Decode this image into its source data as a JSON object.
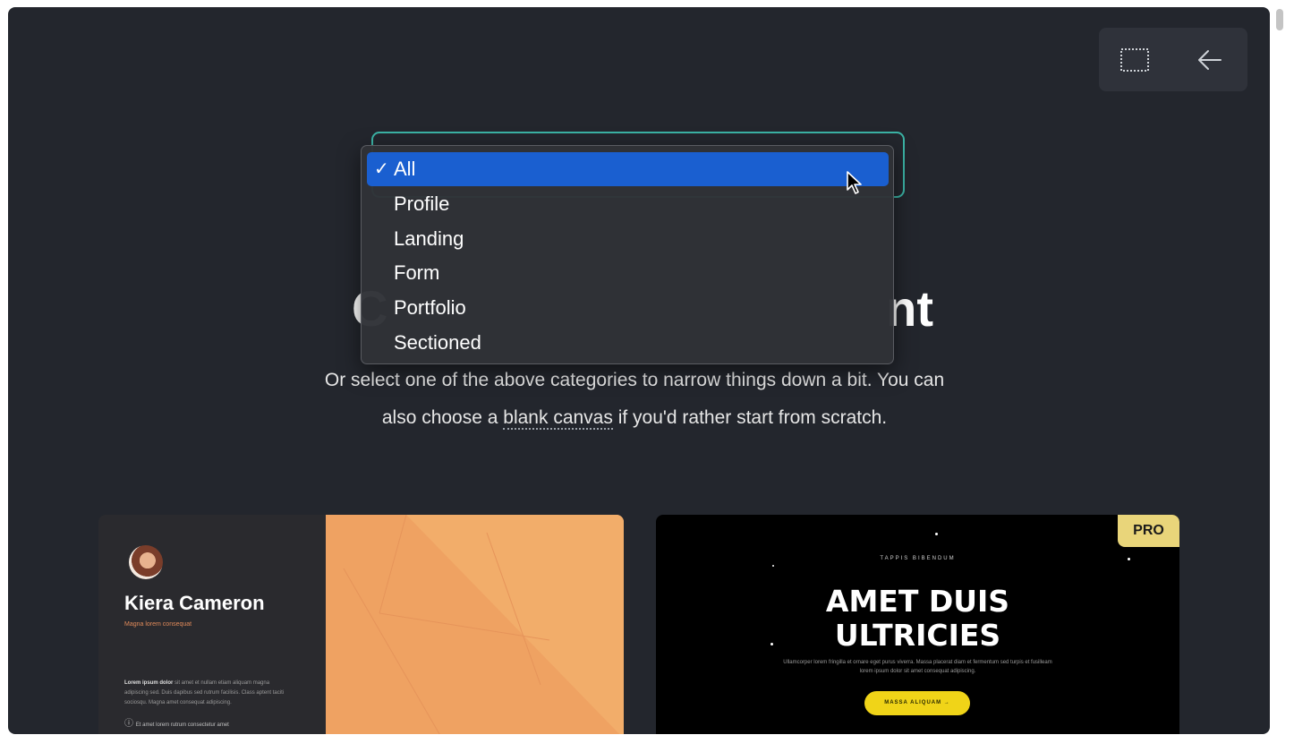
{
  "toolbar": {
    "select_area_icon": "dotted-rectangle-icon",
    "back_icon": "arrow-left-icon"
  },
  "category_select": {
    "accent_color": "#3bb3a5",
    "selected": "All",
    "options": [
      {
        "label": "All",
        "selected": true
      },
      {
        "label": "Profile",
        "selected": false
      },
      {
        "label": "Landing",
        "selected": false
      },
      {
        "label": "Form",
        "selected": false
      },
      {
        "label": "Portfolio",
        "selected": false
      },
      {
        "label": "Sectioned",
        "selected": false
      }
    ],
    "check_mark": "✓",
    "highlight_color": "#1a5fd0"
  },
  "heading": {
    "visible_start": "C",
    "visible_end": "nt"
  },
  "intro": {
    "line1": "Or select one of the above categories to narrow things down a bit. You can",
    "line2_before": "also choose a ",
    "line2_link": "blank canvas",
    "line2_after": " if you'd rather start from scratch."
  },
  "templates": [
    {
      "name": "Kiera Cameron",
      "subtitle": "Magna lorem consequat",
      "body_bold": "Lorem ipsum dolor",
      "body": "sit amet et nullam etiam aliquam magna adipiscing sed. Duis dapibus sed rutrum facilisis. Class aptent taciti sociosqu. Magna amet consequat adipiscing.",
      "pin_text": "Et amet lorem rutrum consectetur amet",
      "bg_color": "#f2ad6a"
    },
    {
      "badge": "PRO",
      "kicker": "TAPPIS BIBENDUM",
      "title_line1": "AMET DUIS",
      "title_line2": "ULTRICIES",
      "body": "Ullamcorper lorem fringilla et ornare eget purus viverra. Massa placerat diam et fermentum sed turpis et fusilleam lorem ipsum dolor sit amet consequat adipiscing.",
      "button": "MASSA ALIQUAM →",
      "badge_color": "#e9d57a",
      "button_color": "#f0d418"
    }
  ]
}
